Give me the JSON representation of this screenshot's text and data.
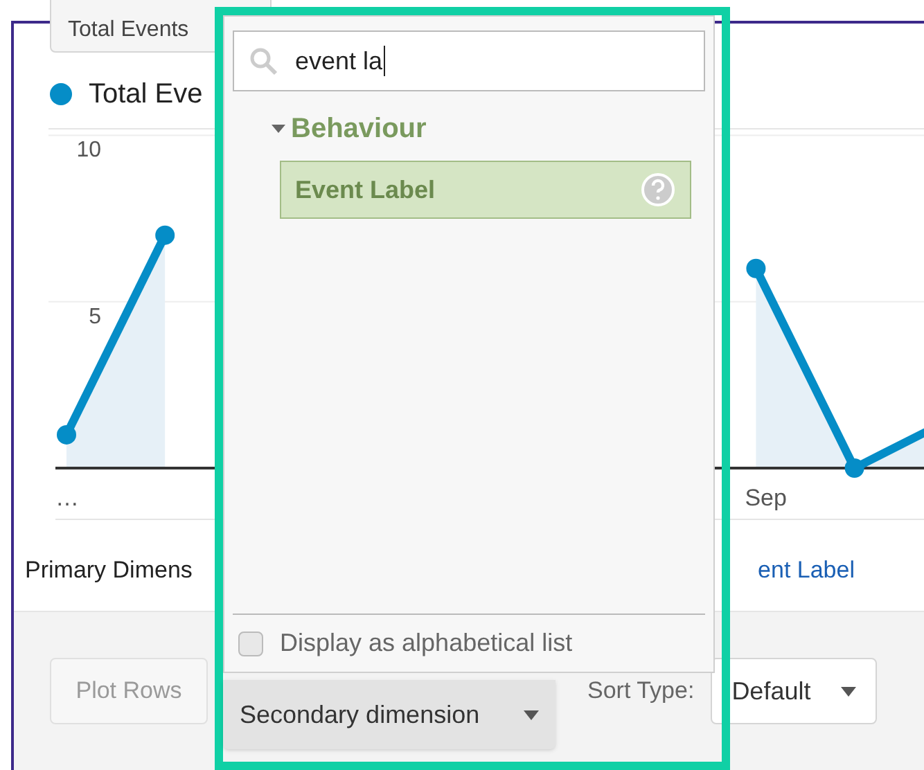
{
  "metric_selector": {
    "metric": "Total Events"
  },
  "chart": {
    "legend": "Total Eve",
    "chart_data": {
      "type": "area",
      "categories": [
        "…",
        null,
        null,
        null,
        null,
        null,
        null,
        "Sep",
        null,
        null
      ],
      "yticks": [
        5,
        10
      ],
      "ylim": [
        0,
        10.2
      ],
      "series": [
        {
          "color": "#058dc7",
          "values": [
            1,
            7,
            null,
            null,
            null,
            null,
            null,
            6,
            0,
            1.5
          ]
        }
      ]
    }
  },
  "primary_dimension": {
    "label": "Primary Dimens",
    "value": "ent Label"
  },
  "toolbar": {
    "plot_rows": {
      "label": "Plot Rows",
      "disabled": true
    },
    "secondary": {
      "label": "Secondary dimension"
    },
    "sort_label": "Sort Type:",
    "sort_value": "Default"
  },
  "dropdown": {
    "search": {
      "value": "event la"
    },
    "groups": [
      {
        "label": "Behaviour",
        "expanded": true,
        "items": [
          {
            "label": "Event Label",
            "selected": true
          }
        ]
      }
    ],
    "alphabetical": {
      "label": "Display as alphabetical list",
      "checked": false
    }
  }
}
